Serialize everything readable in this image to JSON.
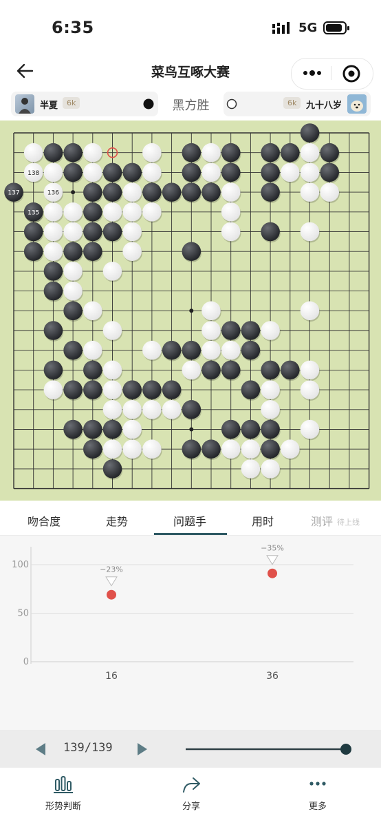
{
  "status_bar": {
    "time": "6:35",
    "network": "5G"
  },
  "header": {
    "title": "菜鸟互啄大赛"
  },
  "players": {
    "black": {
      "name": "半夏",
      "rank": "6k"
    },
    "white": {
      "name": "九十八岁",
      "rank": "6k"
    }
  },
  "result": "黑方胜",
  "board": {
    "size": 19,
    "black_stones": [
      [
        15,
        0
      ],
      [
        2,
        1
      ],
      [
        3,
        1
      ],
      [
        9,
        1
      ],
      [
        11,
        1
      ],
      [
        13,
        1
      ],
      [
        14,
        1
      ],
      [
        16,
        1
      ],
      [
        3,
        2
      ],
      [
        5,
        2
      ],
      [
        6,
        2
      ],
      [
        9,
        2
      ],
      [
        11,
        2
      ],
      [
        13,
        2
      ],
      [
        16,
        2
      ],
      [
        4,
        3
      ],
      [
        5,
        3
      ],
      [
        7,
        3
      ],
      [
        8,
        3
      ],
      [
        9,
        3
      ],
      [
        10,
        3
      ],
      [
        13,
        3
      ],
      [
        1,
        4
      ],
      [
        4,
        4
      ],
      [
        1,
        5
      ],
      [
        4,
        5
      ],
      [
        5,
        5
      ],
      [
        13,
        5
      ],
      [
        1,
        6
      ],
      [
        3,
        6
      ],
      [
        4,
        6
      ],
      [
        9,
        6
      ],
      [
        2,
        7
      ],
      [
        2,
        8
      ],
      [
        3,
        9
      ],
      [
        2,
        10
      ],
      [
        11,
        10
      ],
      [
        12,
        10
      ],
      [
        3,
        11
      ],
      [
        8,
        11
      ],
      [
        9,
        11
      ],
      [
        12,
        11
      ],
      [
        2,
        12
      ],
      [
        4,
        12
      ],
      [
        10,
        12
      ],
      [
        11,
        12
      ],
      [
        13,
        12
      ],
      [
        14,
        12
      ],
      [
        3,
        13
      ],
      [
        4,
        13
      ],
      [
        6,
        13
      ],
      [
        7,
        13
      ],
      [
        8,
        13
      ],
      [
        12,
        13
      ],
      [
        9,
        14
      ],
      [
        3,
        15
      ],
      [
        4,
        15
      ],
      [
        5,
        15
      ],
      [
        11,
        15
      ],
      [
        12,
        15
      ],
      [
        13,
        15
      ],
      [
        4,
        16
      ],
      [
        9,
        16
      ],
      [
        10,
        16
      ],
      [
        13,
        16
      ],
      [
        5,
        17
      ]
    ],
    "white_stones": [
      [
        1,
        1
      ],
      [
        4,
        1
      ],
      [
        7,
        1
      ],
      [
        10,
        1
      ],
      [
        15,
        1
      ],
      [
        2,
        2
      ],
      [
        4,
        2
      ],
      [
        7,
        2
      ],
      [
        10,
        2
      ],
      [
        14,
        2
      ],
      [
        15,
        2
      ],
      [
        6,
        3
      ],
      [
        11,
        3
      ],
      [
        15,
        3
      ],
      [
        16,
        3
      ],
      [
        2,
        4
      ],
      [
        3,
        4
      ],
      [
        5,
        4
      ],
      [
        6,
        4
      ],
      [
        7,
        4
      ],
      [
        11,
        4
      ],
      [
        2,
        5
      ],
      [
        3,
        5
      ],
      [
        6,
        5
      ],
      [
        11,
        5
      ],
      [
        15,
        5
      ],
      [
        2,
        6
      ],
      [
        6,
        6
      ],
      [
        3,
        7
      ],
      [
        5,
        7
      ],
      [
        3,
        8
      ],
      [
        4,
        9
      ],
      [
        10,
        9
      ],
      [
        15,
        9
      ],
      [
        5,
        10
      ],
      [
        10,
        10
      ],
      [
        13,
        10
      ],
      [
        4,
        11
      ],
      [
        7,
        11
      ],
      [
        10,
        11
      ],
      [
        11,
        11
      ],
      [
        5,
        12
      ],
      [
        9,
        12
      ],
      [
        15,
        12
      ],
      [
        2,
        13
      ],
      [
        5,
        13
      ],
      [
        13,
        13
      ],
      [
        15,
        13
      ],
      [
        5,
        14
      ],
      [
        6,
        14
      ],
      [
        7,
        14
      ],
      [
        8,
        14
      ],
      [
        13,
        14
      ],
      [
        6,
        15
      ],
      [
        15,
        15
      ],
      [
        5,
        16
      ],
      [
        6,
        16
      ],
      [
        7,
        16
      ],
      [
        11,
        16
      ],
      [
        12,
        16
      ],
      [
        14,
        16
      ],
      [
        12,
        17
      ],
      [
        13,
        17
      ]
    ],
    "labeled_stones": [
      {
        "label": "137",
        "color": "black",
        "col": 0,
        "row": 3
      },
      {
        "label": "138",
        "color": "white",
        "col": 1,
        "row": 2
      },
      {
        "label": "136",
        "color": "white",
        "col": 2,
        "row": 3
      },
      {
        "label": "135",
        "color": "black",
        "col": 1,
        "row": 4
      }
    ],
    "last_move": {
      "col": 5,
      "row": 1
    }
  },
  "tabs": [
    "吻合度",
    "走势",
    "问题手",
    "用时",
    "测评"
  ],
  "active_tab": "问题手",
  "tab_badge": "待上线",
  "chart_data": {
    "type": "scatter",
    "y_ticks": [
      "100",
      "50",
      "0"
    ],
    "ylim": [
      0,
      100
    ],
    "x_ticks": [
      "16",
      "36"
    ],
    "points": [
      {
        "x": "16",
        "y": 69,
        "label": "−23%"
      },
      {
        "x": "36",
        "y": 91,
        "label": "−35%"
      }
    ],
    "point_color": "#e0514a",
    "grid": true
  },
  "playback": {
    "counter": "139/139",
    "progress": 1.0
  },
  "bottom_nav": [
    {
      "label": "形势判断",
      "icon": "bar-chart-icon"
    },
    {
      "label": "分享",
      "icon": "share-icon"
    },
    {
      "label": "更多",
      "icon": "more-icon"
    }
  ],
  "colors": {
    "board": "#d8e3b2",
    "accent": "#2f5a64",
    "point": "#e0514a"
  }
}
